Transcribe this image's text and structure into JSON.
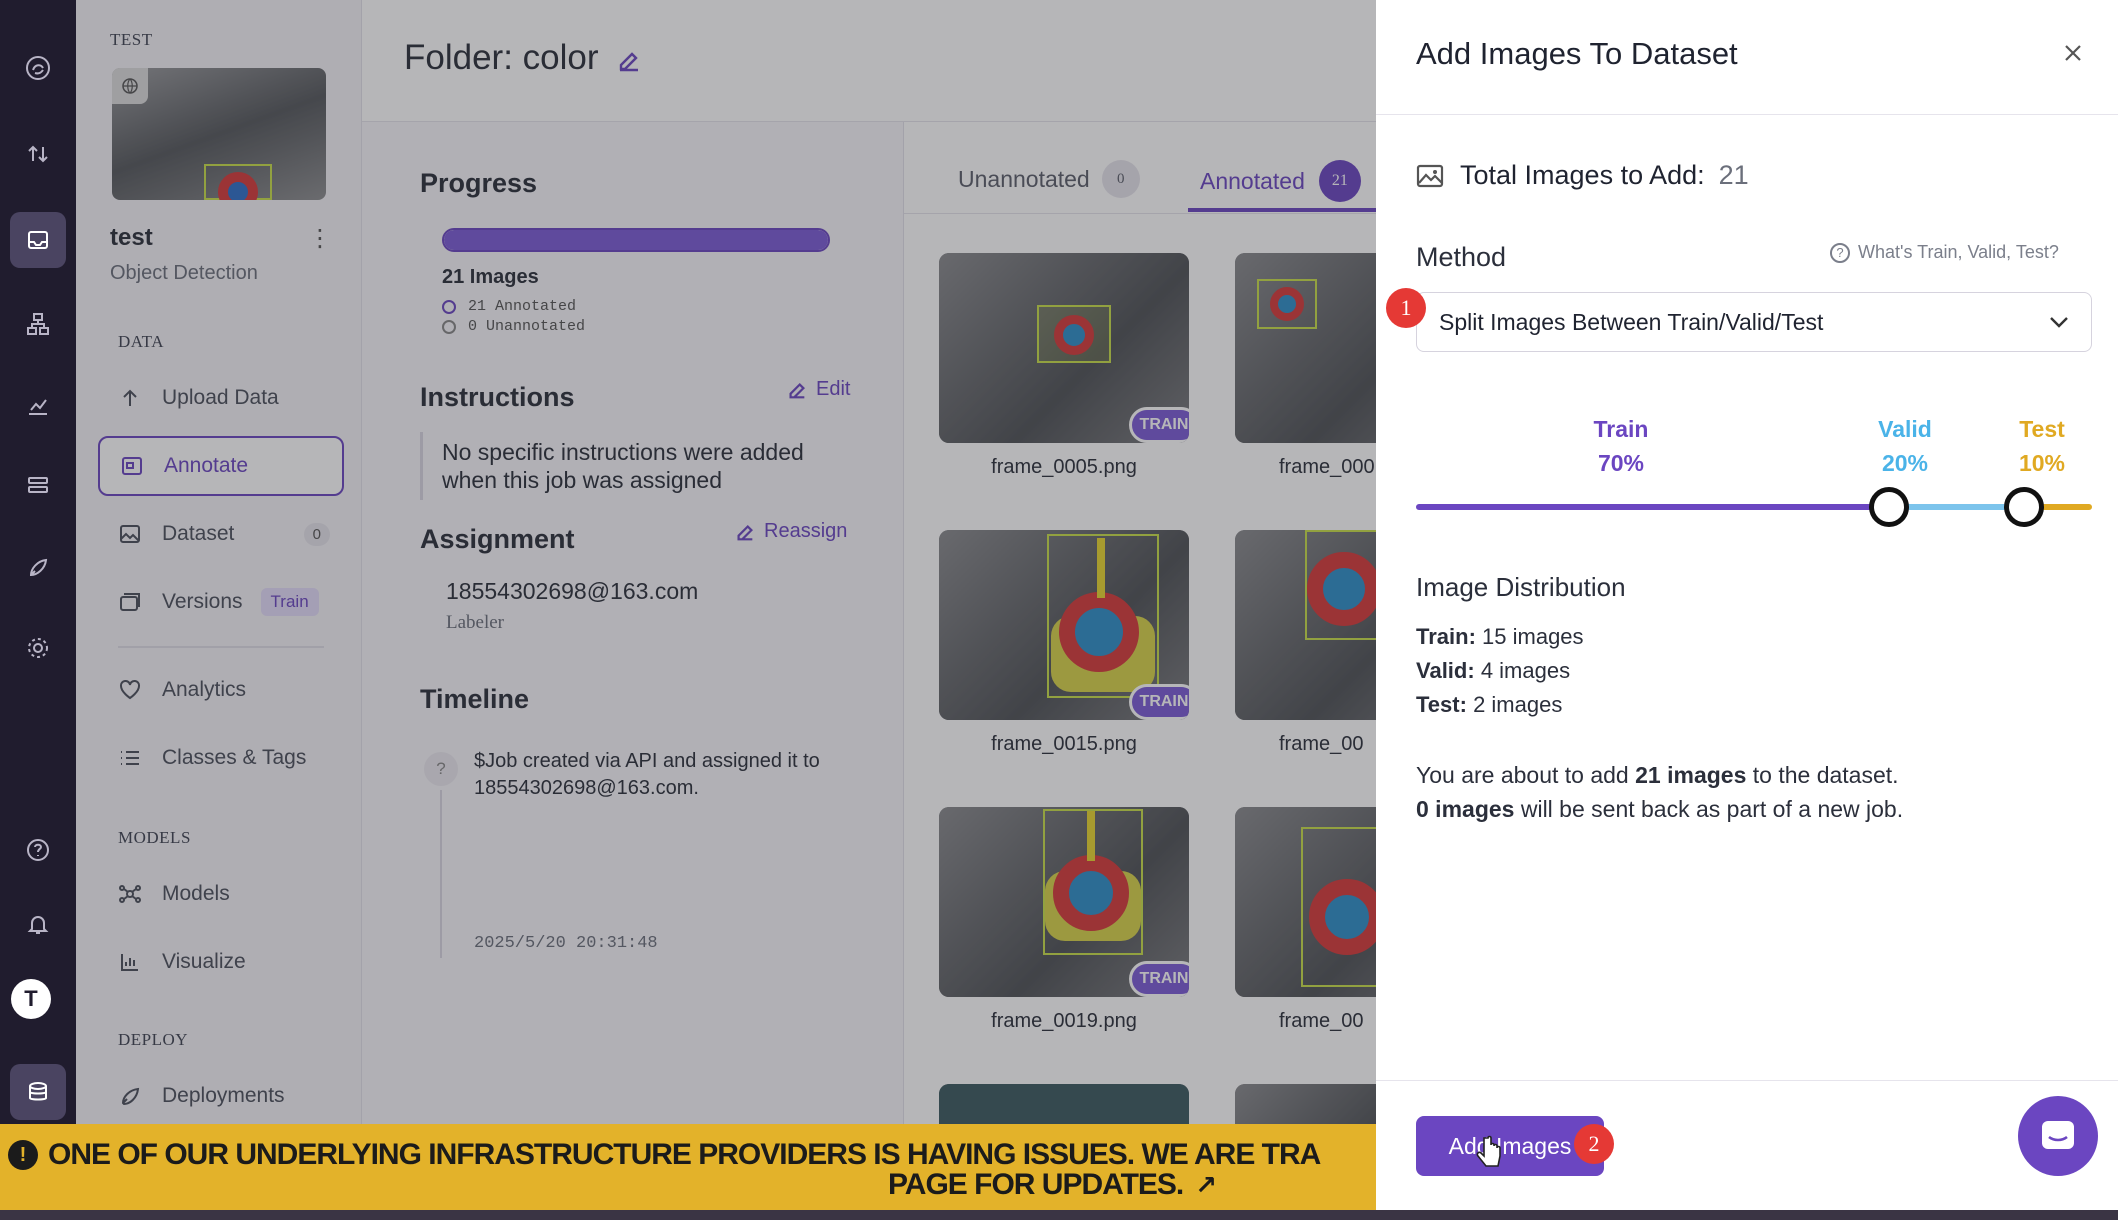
{
  "rail": {
    "avatar_letter": "T",
    "icons": [
      "logo-icon",
      "upload-icon",
      "inbox-icon",
      "sitemap-icon",
      "chart-icon",
      "list-icon",
      "rocket-icon",
      "gear-icon",
      "help-icon",
      "bell-icon",
      "database-icon"
    ]
  },
  "sidebar": {
    "workspace_label": "TEST",
    "project_name": "test",
    "project_type": "Object Detection",
    "section_data": "DATA",
    "section_models": "MODELS",
    "section_deploy": "DEPLOY",
    "items": [
      {
        "label": "Upload Data"
      },
      {
        "label": "Annotate"
      },
      {
        "label": "Dataset",
        "badge": "0"
      },
      {
        "label": "Versions",
        "badge": "Train"
      },
      {
        "label": "Analytics"
      },
      {
        "label": "Classes & Tags"
      },
      {
        "label": "Models"
      },
      {
        "label": "Visualize"
      },
      {
        "label": "Deployments"
      }
    ]
  },
  "header": {
    "title": "Folder: color"
  },
  "progress": {
    "heading": "Progress",
    "fraction_annotated": 1.0,
    "images_count": "21 Images",
    "annotated": "21 Annotated",
    "unannotated": "0 Unannotated"
  },
  "instructions": {
    "heading": "Instructions",
    "edit_label": "Edit",
    "text": "No specific instructions were added when this job was assigned"
  },
  "assignment": {
    "heading": "Assignment",
    "reassign_label": "Reassign",
    "email": "18554302698@163.com",
    "role": "Labeler"
  },
  "timeline": {
    "heading": "Timeline",
    "event": "$Job created via API and assigned it to 18554302698@163.com.",
    "time": "2025/5/20 20:31:48"
  },
  "tabs": {
    "unannotated": {
      "label": "Unannotated",
      "count": "0"
    },
    "annotated": {
      "label": "Annotated",
      "count": "21"
    }
  },
  "gallery": {
    "badge": "TRAIN",
    "files": [
      "frame_0005.png",
      "frame_000",
      "frame_0015.png",
      "frame_00",
      "frame_0019.png",
      "frame_00"
    ]
  },
  "panel": {
    "title": "Add Images To Dataset",
    "total_label": "Total Images to Add:",
    "total_value": "21",
    "method_label": "Method",
    "help_link": "What's Train, Valid, Test?",
    "method_value": "Split Images Between Train/Valid/Test",
    "step1": "1",
    "step2": "2",
    "split": {
      "train_label": "Train",
      "train_pct": "70%",
      "train_fraction": 0.7,
      "valid_label": "Valid",
      "valid_pct": "20%",
      "valid_fraction": 0.2,
      "test_label": "Test",
      "test_pct": "10%",
      "test_fraction": 0.1
    },
    "distribution_heading": "Image Distribution",
    "train_row": {
      "label": "Train:",
      "value": "15 images"
    },
    "valid_row": {
      "label": "Valid:",
      "value": "4 images"
    },
    "test_row": {
      "label": "Test:",
      "value": "2 images"
    },
    "summary1_pre": "You are about to add",
    "summary1_bold": "21 images",
    "summary1_post": "to the dataset.",
    "summary2_bold": "0 images",
    "summary2_post": "will be sent back as part of a new job.",
    "add_button": "Add Images"
  },
  "banner": {
    "line1": "ONE OF OUR UNDERLYING INFRASTRUCTURE PROVIDERS IS HAVING ISSUES. WE ARE TRA",
    "line2": "PAGE FOR UPDATES."
  },
  "colors": {
    "accent": "#6b46c1",
    "train": "#6b46c1",
    "valid": "#4ab3e8",
    "test": "#e0a922",
    "banner": "#e3b22a"
  }
}
